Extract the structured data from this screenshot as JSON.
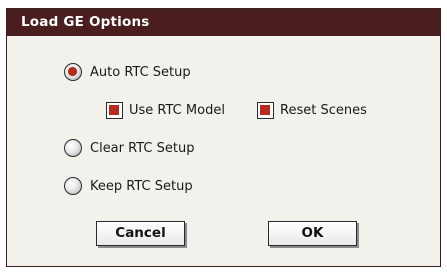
{
  "dialog": {
    "title": "Load GE Options",
    "options": {
      "auto_rtc_setup": {
        "label": "Auto RTC Setup",
        "selected": true
      },
      "use_rtc_model": {
        "label": "Use RTC Model",
        "checked": true
      },
      "reset_scenes": {
        "label": "Reset Scenes",
        "checked": true
      },
      "clear_rtc_setup": {
        "label": "Clear RTC Setup",
        "selected": false
      },
      "keep_rtc_setup": {
        "label": "Keep RTC Setup",
        "selected": false
      }
    },
    "buttons": {
      "cancel": "Cancel",
      "ok": "OK"
    },
    "colors": {
      "title_bar": "#4a1e1e",
      "accent": "#b82a1c",
      "background": "#f3f1ec"
    }
  }
}
